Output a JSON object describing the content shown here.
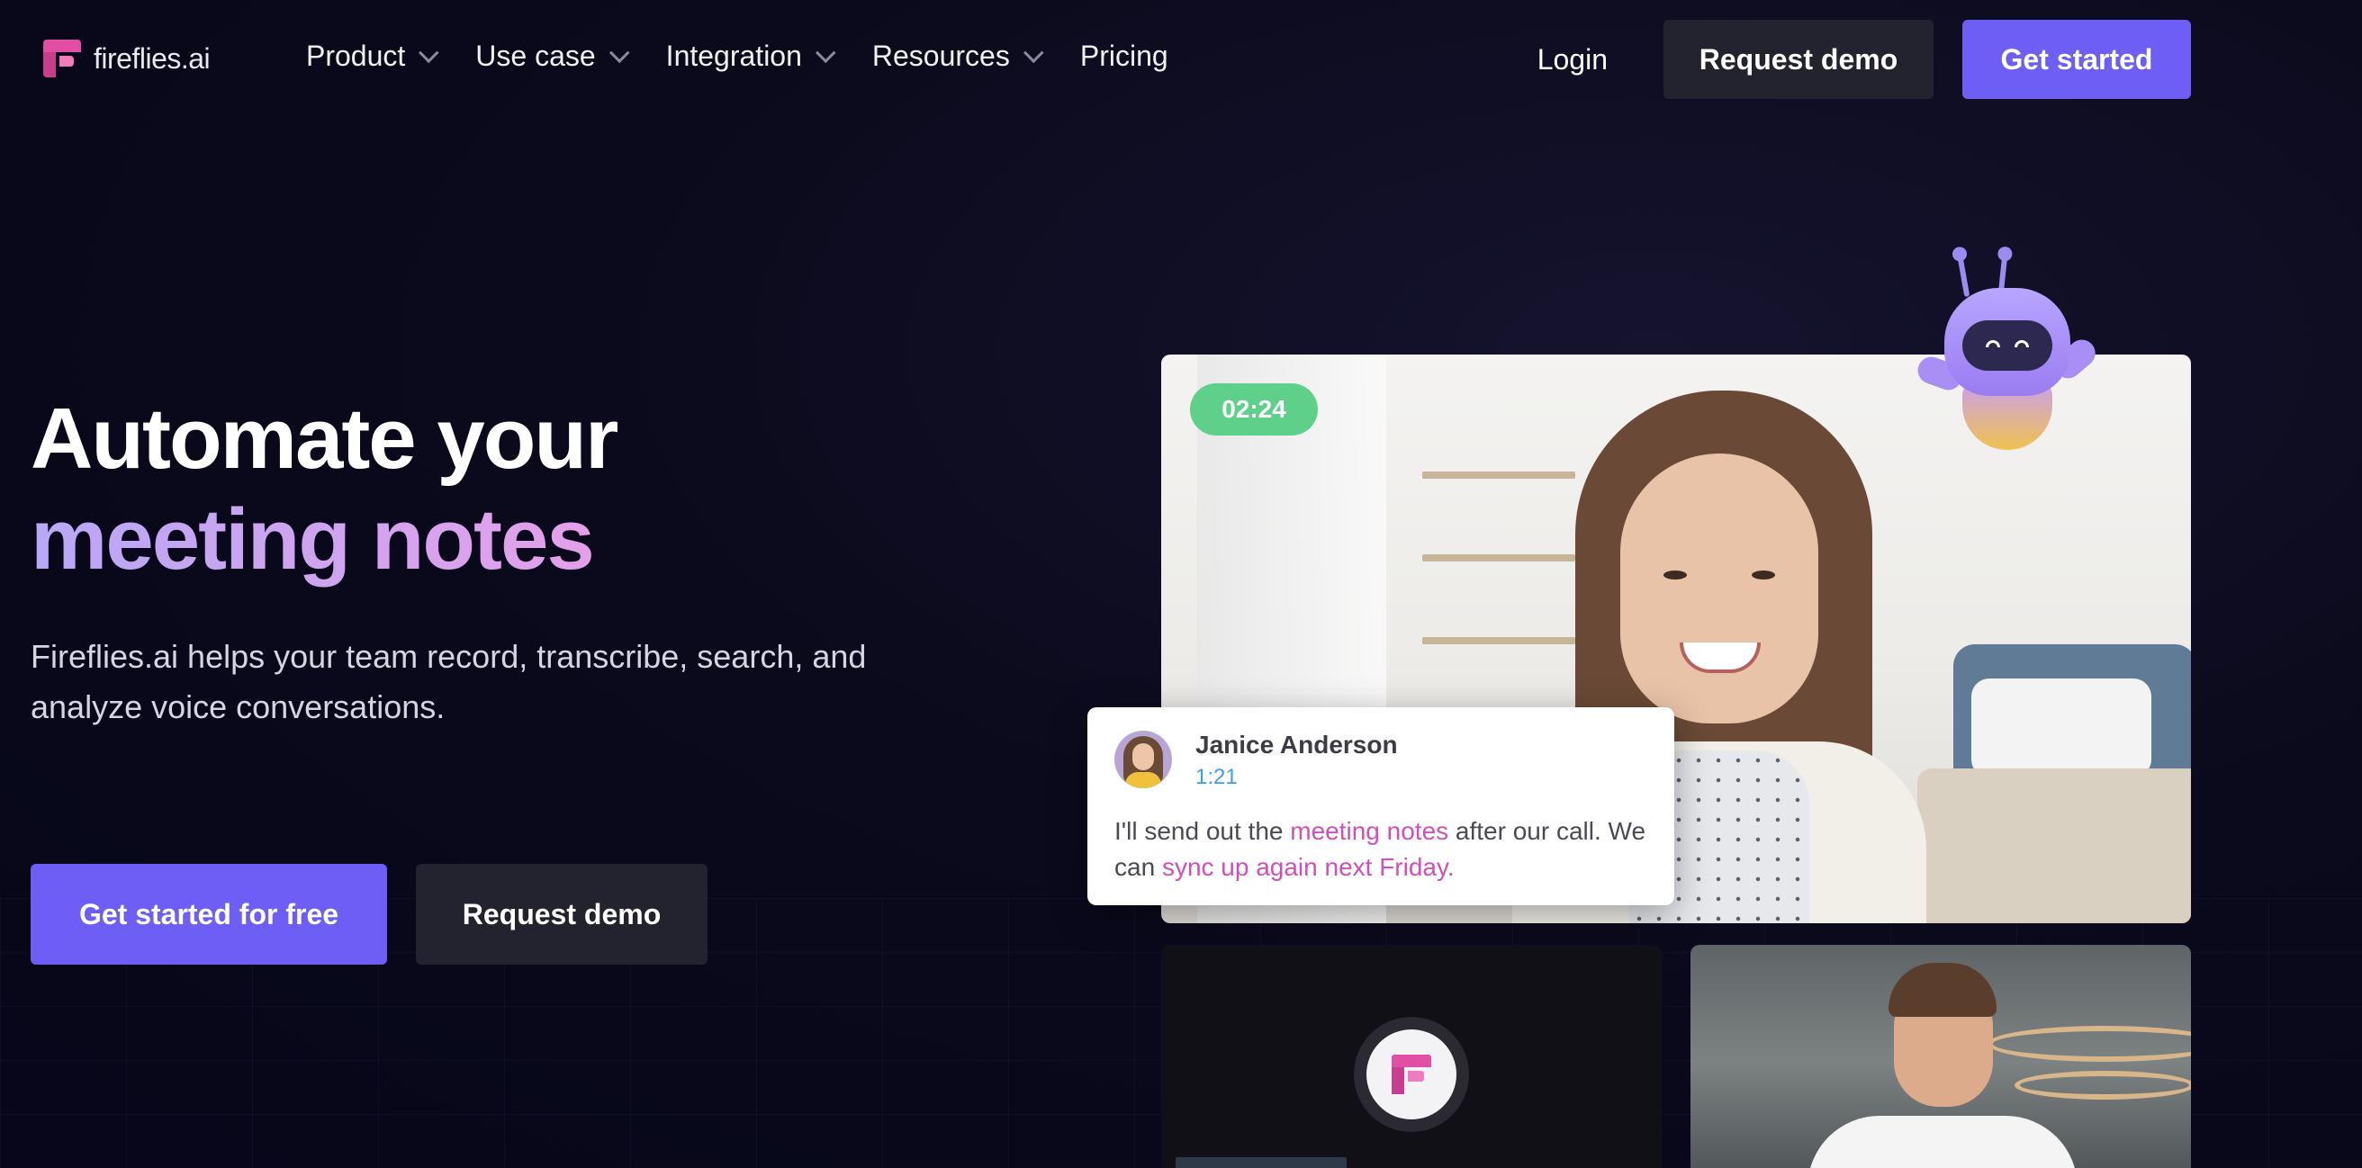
{
  "brand": {
    "name": "fireflies.ai"
  },
  "nav": {
    "items": [
      {
        "label": "Product",
        "has_dropdown": true
      },
      {
        "label": "Use case",
        "has_dropdown": true
      },
      {
        "label": "Integration",
        "has_dropdown": true
      },
      {
        "label": "Resources",
        "has_dropdown": true
      },
      {
        "label": "Pricing",
        "has_dropdown": false
      }
    ],
    "login": "Login",
    "request_demo": "Request demo",
    "get_started": "Get started"
  },
  "hero": {
    "title_line1": "Automate your",
    "title_line2": "meeting notes",
    "subtitle": "Fireflies.ai helps your team record, transcribe, search, and analyze voice conversations.",
    "cta_primary": "Get started for free",
    "cta_secondary": "Request demo"
  },
  "video": {
    "timer": "02:24",
    "transcript": {
      "speaker": "Janice Anderson",
      "time": "1:21",
      "text_part1": "I'll send out the ",
      "highlight1": "meeting notes",
      "text_part2": " after our call. We can ",
      "highlight2": "sync up again next Friday."
    }
  },
  "colors": {
    "accent": "#6d5ef5",
    "dark_button": "#23222f",
    "timer": "#5fd08a",
    "highlight": "#d04fb9",
    "background": "#0b0a1c"
  },
  "icons": [
    "fireflies-logo-icon",
    "chevron-down-icon",
    "robot-mascot-icon"
  ]
}
